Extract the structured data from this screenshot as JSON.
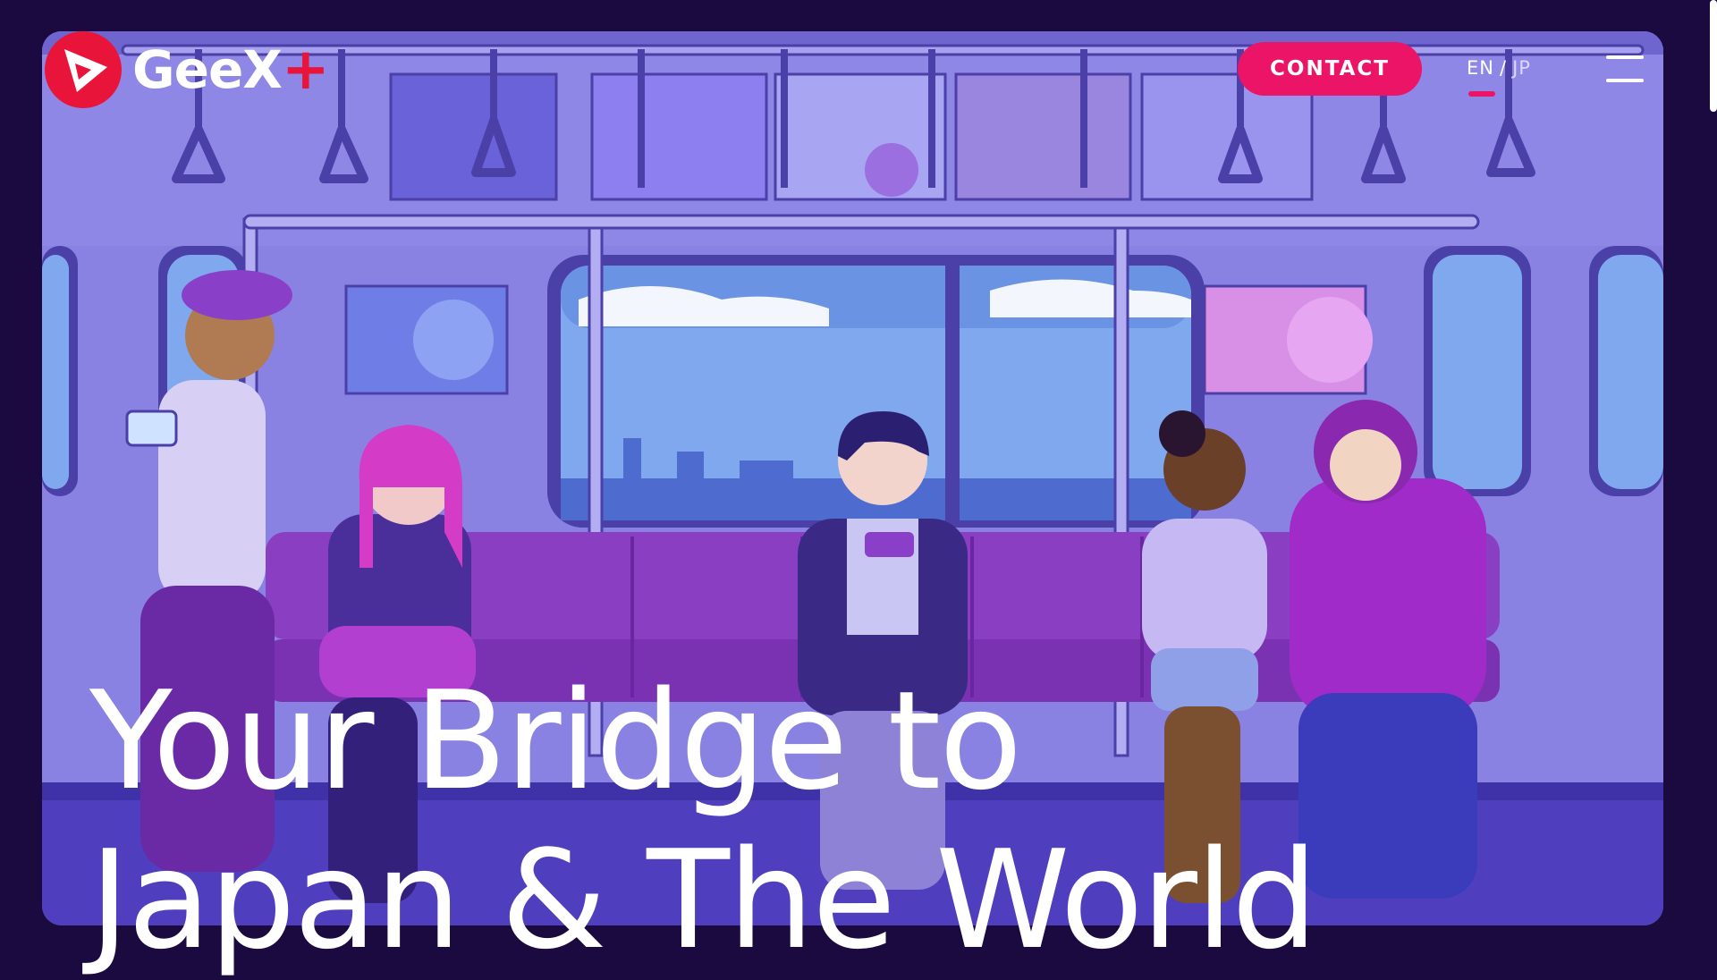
{
  "brand": {
    "name": "GeeX",
    "plus": "+",
    "accent_color": "#e8143a",
    "logo_icon": "play-triangle-icon"
  },
  "header": {
    "contact_label": "CONTACT",
    "contact_color": "#ec1466",
    "lang_en": "EN",
    "lang_separator": "/",
    "lang_jp": "JP",
    "active_language": "EN",
    "menu_icon": "hamburger-menu-icon"
  },
  "hero": {
    "title_line_1": "Your Bridge to",
    "title_line_2": "Japan & The World",
    "illustration": "subway-car-passengers-illustration"
  },
  "colors": {
    "page_background": "#1a0a40",
    "illustration_base": "#7a73d8"
  }
}
